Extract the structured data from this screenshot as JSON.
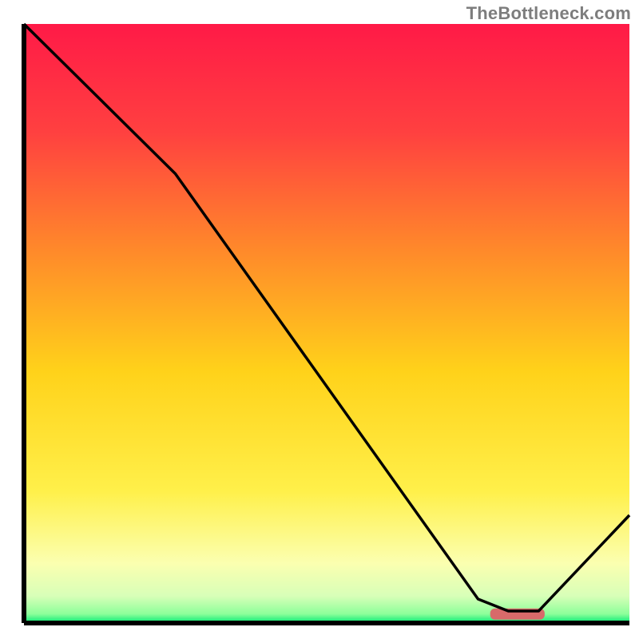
{
  "attribution": "TheBottleneck.com",
  "chart_data": {
    "type": "line",
    "title": "",
    "xlabel": "",
    "ylabel": "",
    "xlim": [
      0,
      100
    ],
    "ylim": [
      0,
      100
    ],
    "x": [
      0,
      25,
      75,
      80,
      85,
      100
    ],
    "values": [
      100,
      75,
      4,
      2,
      2,
      18
    ],
    "marker": {
      "x_start": 77,
      "x_end": 86,
      "y": 1.5
    },
    "background_gradient": {
      "stops": [
        {
          "offset": 0.0,
          "color": "#ff1a47"
        },
        {
          "offset": 0.18,
          "color": "#ff4040"
        },
        {
          "offset": 0.38,
          "color": "#ff8a2a"
        },
        {
          "offset": 0.58,
          "color": "#ffd21a"
        },
        {
          "offset": 0.78,
          "color": "#fff04a"
        },
        {
          "offset": 0.9,
          "color": "#fbffb0"
        },
        {
          "offset": 0.955,
          "color": "#d8ffb8"
        },
        {
          "offset": 0.985,
          "color": "#8cff9a"
        },
        {
          "offset": 1.0,
          "color": "#00e873"
        }
      ]
    },
    "marker_color": "#d86a6a",
    "line_color": "#000000"
  }
}
